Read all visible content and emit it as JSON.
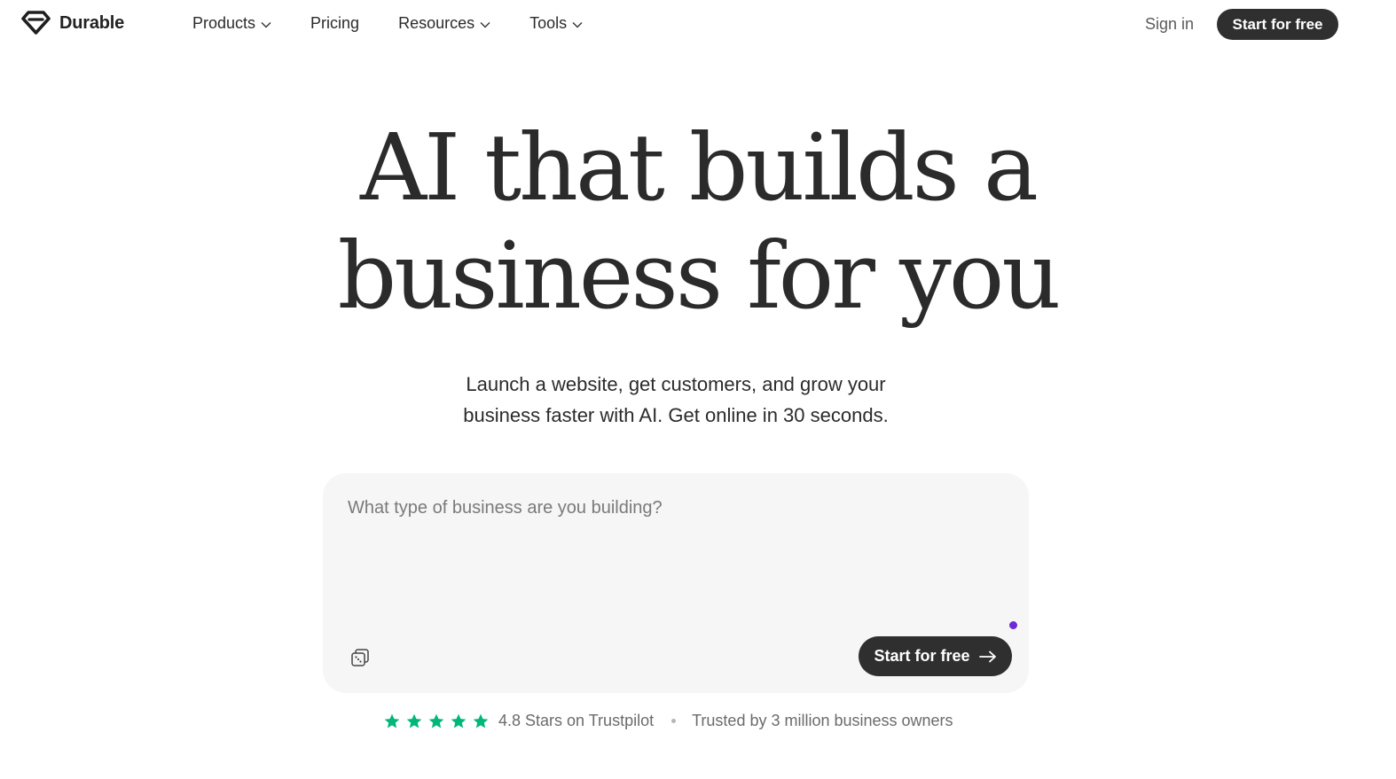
{
  "brand": {
    "name": "Durable"
  },
  "nav": {
    "items": [
      {
        "label": "Products",
        "has_dropdown": true
      },
      {
        "label": "Pricing",
        "has_dropdown": false
      },
      {
        "label": "Resources",
        "has_dropdown": true
      },
      {
        "label": "Tools",
        "has_dropdown": true
      }
    ],
    "sign_in": "Sign in",
    "cta": "Start for free"
  },
  "hero": {
    "title_line1": "AI that builds a",
    "title_line2": "business for you",
    "subtitle_line1": "Launch a website, get customers, and grow your",
    "subtitle_line2": "business faster with AI. Get online in 30 seconds."
  },
  "prompt": {
    "value": "",
    "placeholder": "What type of business are you building?",
    "cta": "Start for free",
    "shuffle_icon": "shuffle-dice-icon",
    "arrow_icon": "arrow-right-icon",
    "accent_dot_color": "#6d28d9"
  },
  "trust": {
    "rating_stars": 5,
    "star_color": "#00b67a",
    "rating_text": "4.8 Stars on Trustpilot",
    "trusted_text": "Trusted by 3 million business owners"
  },
  "colors": {
    "cta_bg": "#2f2f2f",
    "prompt_bg": "#f6f6f6",
    "text": "#2b2b2b"
  }
}
